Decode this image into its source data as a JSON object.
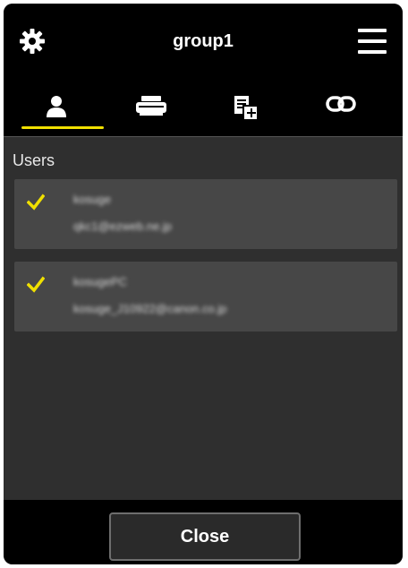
{
  "header": {
    "title": "group1",
    "settings_icon": "gear-icon",
    "menu_icon": "hamburger-menu-icon"
  },
  "tabs": [
    {
      "name": "users",
      "icon": "user-icon",
      "active": true
    },
    {
      "name": "printers",
      "icon": "printer-icon",
      "active": false
    },
    {
      "name": "documents",
      "icon": "document-icon",
      "active": false
    },
    {
      "name": "links",
      "icon": "link-icon",
      "active": false
    }
  ],
  "users_section": {
    "label": "Users",
    "items": [
      {
        "name": "kosuge",
        "email": "qkc1@ezweb.ne.jp",
        "checked": true
      },
      {
        "name": "kosugePC",
        "email": "kosuge_J10922@canon.co.jp",
        "checked": true
      }
    ]
  },
  "footer": {
    "close_label": "Close"
  },
  "colors": {
    "accent": "#f0e000",
    "background": "#2f2f2f",
    "bar": "#000000",
    "card": "#474747"
  }
}
